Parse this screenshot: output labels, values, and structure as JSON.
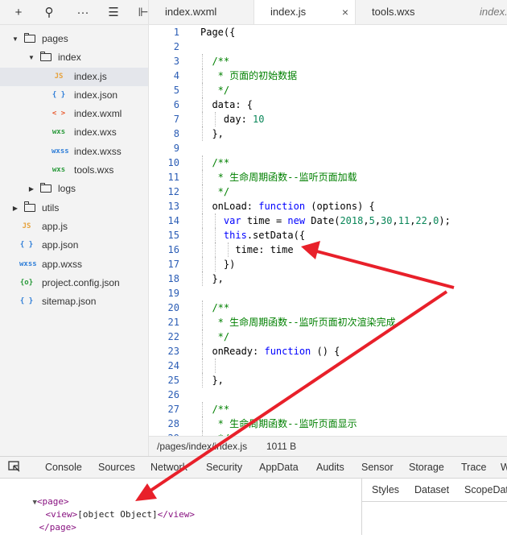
{
  "sidebar": {
    "toolbar": [
      {
        "name": "add-icon",
        "glyph": "+"
      },
      {
        "name": "search-icon",
        "glyph": "⚲"
      },
      {
        "name": "more-icon",
        "glyph": "···"
      },
      {
        "name": "sort-icon",
        "glyph": "☰"
      },
      {
        "name": "collapse-icon",
        "glyph": "⊩"
      }
    ],
    "items": [
      {
        "label": "pages",
        "kind": "folder",
        "depth": 0,
        "expanded": true
      },
      {
        "label": "index",
        "kind": "folder",
        "depth": 1,
        "expanded": true
      },
      {
        "label": "index.js",
        "kind": "js",
        "depth": 2,
        "selected": true
      },
      {
        "label": "index.json",
        "kind": "json",
        "depth": 2
      },
      {
        "label": "index.wxml",
        "kind": "wxml",
        "depth": 2
      },
      {
        "label": "index.wxs",
        "kind": "wxs",
        "depth": 2
      },
      {
        "label": "index.wxss",
        "kind": "wxss",
        "depth": 2
      },
      {
        "label": "tools.wxs",
        "kind": "wxs",
        "depth": 2
      },
      {
        "label": "logs",
        "kind": "folder",
        "depth": 1,
        "expanded": false
      },
      {
        "label": "utils",
        "kind": "folder",
        "depth": 0,
        "expanded": false
      },
      {
        "label": "app.js",
        "kind": "js",
        "depth": 0
      },
      {
        "label": "app.json",
        "kind": "json",
        "depth": 0
      },
      {
        "label": "app.wxss",
        "kind": "wxss",
        "depth": 0
      },
      {
        "label": "project.config.json",
        "kind": "config",
        "depth": 0
      },
      {
        "label": "sitemap.json",
        "kind": "json",
        "depth": 0
      }
    ],
    "icons": {
      "js": {
        "glyph": "JS",
        "color": "#e6a23c"
      },
      "json": {
        "glyph": "{ }",
        "color": "#2f7ed8"
      },
      "wxml": {
        "glyph": "< >",
        "color": "#e8562a"
      },
      "wxs": {
        "glyph": "wxs",
        "color": "#2a9a3b"
      },
      "wxss": {
        "glyph": "wxss",
        "color": "#2f7ed8"
      },
      "config": {
        "glyph": "{o}",
        "color": "#2a9a3b"
      }
    }
  },
  "tabs": [
    {
      "label": "index.wxml",
      "active": false
    },
    {
      "label": "index.js",
      "active": true,
      "close": "×"
    },
    {
      "label": "tools.wxs",
      "active": false
    },
    {
      "label": "index.",
      "active": false,
      "italic": true
    }
  ],
  "editor": {
    "lines": [
      [
        [
          "p",
          "Page({"
        ]
      ],
      [],
      [
        [
          "c",
          "  /**"
        ]
      ],
      [
        [
          "c",
          "   * 页面的初始数据"
        ]
      ],
      [
        [
          "c",
          "   */"
        ]
      ],
      [
        [
          "p",
          "  data: {"
        ]
      ],
      [
        [
          "p",
          "    day: "
        ],
        [
          "n",
          "10"
        ]
      ],
      [
        [
          "p",
          "  },"
        ]
      ],
      [],
      [
        [
          "c",
          "  /**"
        ]
      ],
      [
        [
          "c",
          "   * 生命周期函数--监听页面加载"
        ]
      ],
      [
        [
          "c",
          "   */"
        ]
      ],
      [
        [
          "p",
          "  onLoad: "
        ],
        [
          "k",
          "function"
        ],
        [
          "p",
          " (options) {"
        ]
      ],
      [
        [
          "p",
          "    "
        ],
        [
          "k",
          "var"
        ],
        [
          "p",
          " time = "
        ],
        [
          "k",
          "new"
        ],
        [
          "p",
          " Date("
        ],
        [
          "n",
          "2018"
        ],
        [
          "p",
          ","
        ],
        [
          "n",
          "5"
        ],
        [
          "p",
          ","
        ],
        [
          "n",
          "30"
        ],
        [
          "p",
          ","
        ],
        [
          "n",
          "11"
        ],
        [
          "p",
          ","
        ],
        [
          "n",
          "22"
        ],
        [
          "p",
          ","
        ],
        [
          "n",
          "0"
        ],
        [
          "p",
          ");"
        ]
      ],
      [
        [
          "p",
          "    "
        ],
        [
          "k",
          "this"
        ],
        [
          "p",
          ".setData({"
        ]
      ],
      [
        [
          "p",
          "      time: time"
        ]
      ],
      [
        [
          "p",
          "    })"
        ]
      ],
      [
        [
          "p",
          "  },"
        ]
      ],
      [],
      [
        [
          "c",
          "  /**"
        ]
      ],
      [
        [
          "c",
          "   * 生命周期函数--监听页面初次渲染完成"
        ]
      ],
      [
        [
          "c",
          "   */"
        ]
      ],
      [
        [
          "p",
          "  onReady: "
        ],
        [
          "k",
          "function"
        ],
        [
          "p",
          " () {"
        ]
      ],
      [],
      [
        [
          "p",
          "  },"
        ]
      ],
      [],
      [
        [
          "c",
          "  /**"
        ]
      ],
      [
        [
          "c",
          "   * 生命周期函数--监听页面显示"
        ]
      ],
      [
        [
          "c",
          "   */"
        ]
      ]
    ]
  },
  "status": {
    "path": "/pages/index/index.js",
    "size": "1011 B"
  },
  "devtools": {
    "tabs": [
      "Console",
      "Sources",
      "Network",
      "Security",
      "AppData",
      "Audits",
      "Sensor",
      "Storage",
      "Trace",
      "Wxml"
    ],
    "tree": {
      "open": "<page>",
      "child_open": "<view>",
      "child_text": "[object Object]",
      "child_close": "</view>",
      "close": "</page>",
      "toggle": "▼"
    },
    "side_tabs": [
      "Styles",
      "Dataset",
      "ScopeData"
    ]
  },
  "colors": {
    "arrow": "#e8202a",
    "keyword": "#0000ff",
    "comment": "#008000",
    "number": "#098658",
    "line_number": "#2b5db5"
  }
}
